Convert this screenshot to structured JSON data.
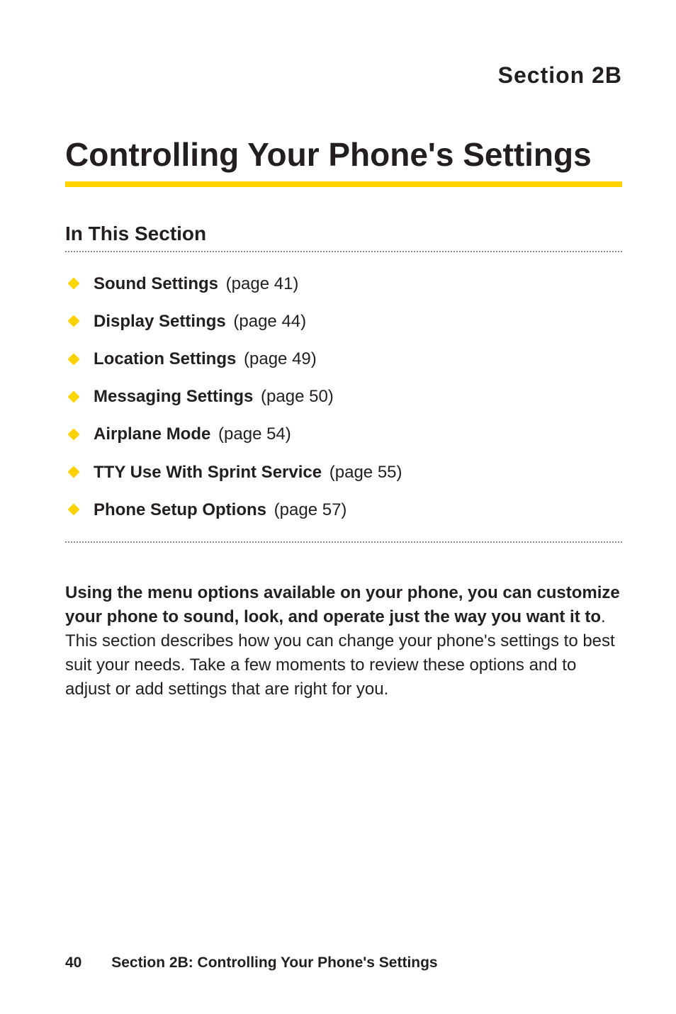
{
  "section_label": "Section 2B",
  "chapter_title": "Controlling Your Phone's Settings",
  "subsection_title": "In This Section",
  "toc": [
    {
      "title": "Sound Settings",
      "page": "(page 41)"
    },
    {
      "title": "Display Settings",
      "page": "(page 44)"
    },
    {
      "title": "Location Settings",
      "page": "(page 49)"
    },
    {
      "title": "Messaging Settings",
      "page": "(page 50)"
    },
    {
      "title": "Airplane Mode",
      "page": "(page 54)"
    },
    {
      "title": "TTY Use With Sprint Service",
      "page": "(page 55)"
    },
    {
      "title": "Phone Setup Options",
      "page": "(page 57)"
    }
  ],
  "body": {
    "lead": "Using the menu options available on your phone, you can customize your phone to sound, look, and operate just the way you want it to",
    "rest": ". This section describes how you can change your phone's settings to best suit your needs. Take a few moments to review these options and to adjust or add settings that are right for you."
  },
  "footer": {
    "page_number": "40",
    "running_title": "Section 2B: Controlling Your Phone's Settings"
  }
}
